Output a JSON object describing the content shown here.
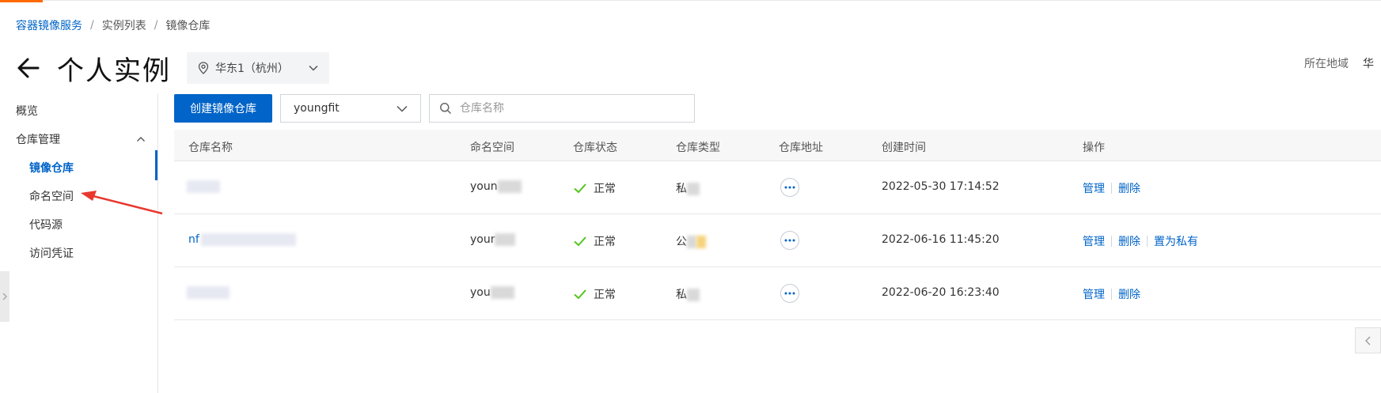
{
  "breadcrumb": {
    "items": [
      "容器镜像服务",
      "实例列表",
      "镜像仓库"
    ]
  },
  "header": {
    "title": "个人实例",
    "region_select": "华东1（杭州）",
    "region_label": "所在地域",
    "region_value_cut": "华"
  },
  "sidebar": {
    "items": [
      {
        "label": "概览"
      },
      {
        "label": "仓库管理"
      },
      {
        "label": "镜像仓库"
      },
      {
        "label": "命名空间"
      },
      {
        "label": "代码源"
      },
      {
        "label": "访问凭证"
      }
    ]
  },
  "toolbar": {
    "create_label": "创建镜像仓库",
    "namespace_value": "youngfit",
    "search_placeholder": "仓库名称"
  },
  "table": {
    "columns": [
      "仓库名称",
      "命名空间",
      "仓库状态",
      "仓库类型",
      "仓库地址",
      "创建时间",
      "操作"
    ],
    "rows": [
      {
        "name": "",
        "namespace": "youn",
        "status": "正常",
        "type": "私",
        "created": "2022-05-30 17:14:52",
        "ops": [
          "管理",
          "删除"
        ]
      },
      {
        "name": "nf",
        "namespace": "your",
        "status": "正常",
        "type": "公",
        "created": "2022-06-16 11:45:20",
        "ops": [
          "管理",
          "删除",
          "置为私有"
        ]
      },
      {
        "name": "",
        "namespace": "you",
        "status": "正常",
        "type": "私",
        "created": "2022-06-20 16:23:40",
        "ops": [
          "管理",
          "删除"
        ]
      }
    ]
  },
  "colors": {
    "accent": "#0064c8",
    "success": "#52c41a",
    "brand": "#ff6a00",
    "annotation": "#e8382e"
  }
}
